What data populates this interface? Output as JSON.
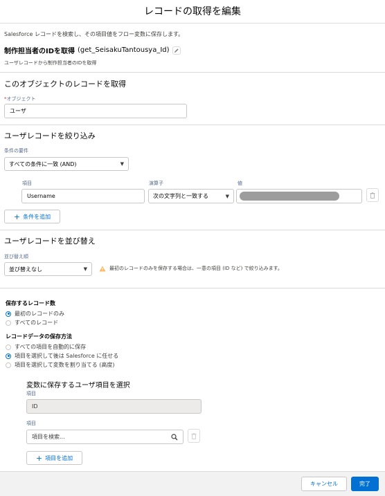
{
  "modal": {
    "title": "レコードの取得を編集"
  },
  "intro": {
    "description": "Salesforce レコードを検索し、その項目値をフロー変数に保存します。",
    "element_label": "制作担当者のIDを取得",
    "api_name": "(get_SeisakuTantousya_Id)",
    "element_description": "ユーザレコードから制作担当者のIDを取得"
  },
  "object_section": {
    "heading": "このオブジェクトのレコードを取得",
    "required_mark": "*",
    "object_label": "オブジェクト",
    "object_value": "ユーザ"
  },
  "filter_section": {
    "heading": "ユーザレコードを絞り込み",
    "requirement_label": "条件の要件",
    "requirement_value": "すべての条件に一致 (AND)",
    "col_field": "項目",
    "col_operator": "演算子",
    "col_value": "値",
    "row": {
      "field": "Username",
      "operator": "次の文字列と一致する",
      "value": ""
    },
    "add_condition": "条件を追加"
  },
  "sort_section": {
    "heading": "ユーザレコードを並び替え",
    "sort_order_label": "並び替え順",
    "sort_order_value": "並び替えなし",
    "warning": "最初のレコードのみを保存する場合は、一意の項目 (ID など) で絞り込みます。"
  },
  "store_section": {
    "count_heading": "保存するレコード数",
    "count_options": [
      "最初のレコードのみ",
      "すべてのレコード"
    ],
    "count_selected": 0,
    "method_heading": "レコードデータの保存方法",
    "method_options": [
      "すべての項目を自動的に保存",
      "項目を選択して後は Salesforce に任せる",
      "項目を選択して変数を割り当てる (高度)"
    ],
    "method_selected": 1
  },
  "fields_section": {
    "heading": "変数に保存するユーザ項目を選択",
    "field1_label": "項目",
    "field1_value": "ID",
    "field2_label": "項目",
    "field2_placeholder": "項目を検索...",
    "add_field": "項目を追加"
  },
  "footer": {
    "cancel": "キャンセル",
    "done": "完了"
  },
  "colors": {
    "brand": "#0070d2",
    "warning": "#ffb75d",
    "footer_bg": "#f3f2f2"
  }
}
